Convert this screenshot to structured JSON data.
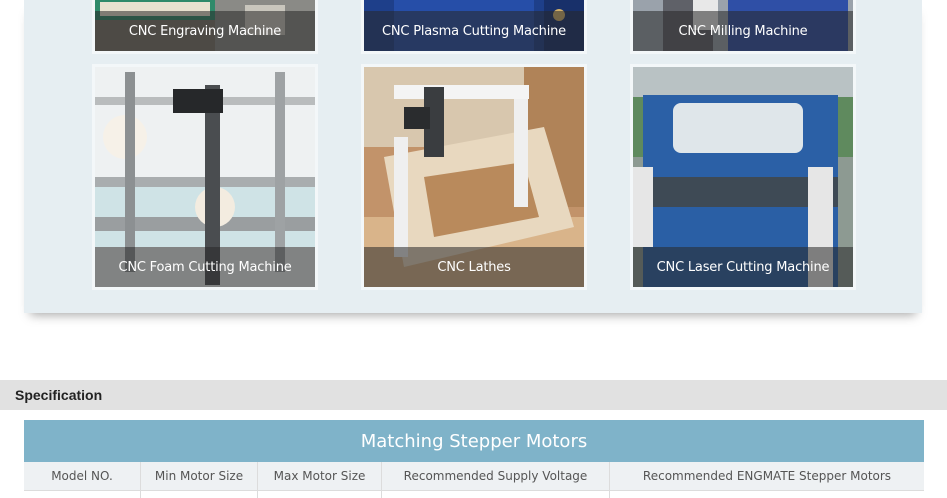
{
  "gallery": {
    "items": [
      {
        "caption": "CNC Engraving Machine",
        "icon": "cnc-engraving-photo"
      },
      {
        "caption": "CNC Plasma Cutting Machine",
        "icon": "cnc-plasma-photo"
      },
      {
        "caption": "CNC Milling Machine",
        "icon": "cnc-milling-photo"
      },
      {
        "caption": "CNC Foam Cutting Machine",
        "icon": "cnc-foam-photo"
      },
      {
        "caption": "CNC Lathes",
        "icon": "cnc-lathe-photo"
      },
      {
        "caption": "CNC Laser Cutting Machine",
        "icon": "cnc-laser-photo"
      }
    ]
  },
  "specification": {
    "heading": "Specification"
  },
  "table": {
    "title": "Matching Stepper Motors",
    "columns": [
      "Model NO.",
      "Min Motor Size",
      "Max Motor Size",
      "Recommended Supply Voltage",
      "Recommended ENGMATE Stepper Motors"
    ]
  },
  "colors": {
    "panel": "#e6eef2",
    "table_header": "#7fb3c9",
    "caption_overlay": "rgba(40,40,40,0.55)"
  }
}
